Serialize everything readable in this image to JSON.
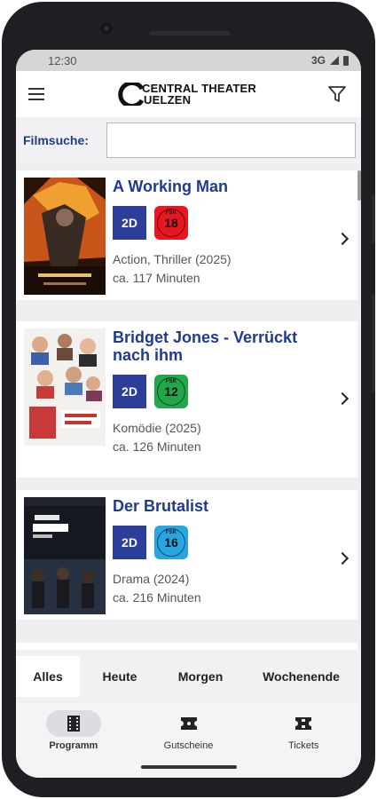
{
  "status_bar": {
    "time": "12:30",
    "network": "3G"
  },
  "header": {
    "logo_line1": "CENTRAL THEATER",
    "logo_line2": "UELZEN"
  },
  "search": {
    "label": "Filmsuche:",
    "value": "",
    "placeholder": ""
  },
  "movies": [
    {
      "title": "A Working Man",
      "format": "2D",
      "fsk": "18",
      "fsk_color": "#e8161e",
      "genre": "Action, Thriller (2025)",
      "duration": "ca. 117 Minuten"
    },
    {
      "title": "Bridget Jones - Verrückt nach ihm",
      "format": "2D",
      "fsk": "12",
      "fsk_color": "#22a84a",
      "genre": "Komödie (2025)",
      "duration": "ca. 126 Minuten"
    },
    {
      "title": "Der Brutalist",
      "format": "2D",
      "fsk": "16",
      "fsk_color": "#27a6e1",
      "genre": "Drama (2024)",
      "duration": "ca. 216 Minuten"
    }
  ],
  "tabs": [
    "Alles",
    "Heute",
    "Morgen",
    "Wochenende"
  ],
  "active_tab": "Alles",
  "bottom_nav": [
    {
      "label": "Programm",
      "icon": "film-strip-icon",
      "active": true
    },
    {
      "label": "Gutscheine",
      "icon": "voucher-ticket-icon",
      "active": false
    },
    {
      "label": "Tickets",
      "icon": "tickets-icon",
      "active": false
    }
  ],
  "colors": {
    "accent": "#1f3a93",
    "format_badge": "#2d3e9a"
  }
}
